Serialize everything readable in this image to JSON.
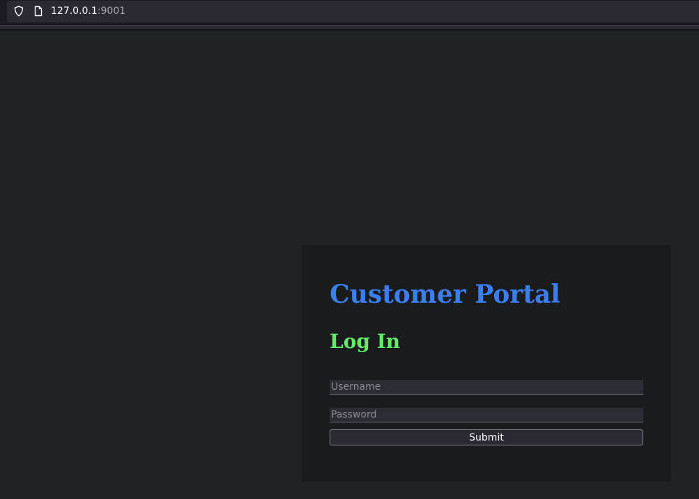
{
  "browser": {
    "url_host": "127.0.0.1",
    "url_port": ":9001",
    "icons": {
      "security": "shield-icon",
      "page": "page-icon"
    }
  },
  "card": {
    "portal_title": "Customer Portal",
    "login_title": "Log In",
    "username_placeholder": "Username",
    "password_placeholder": "Password",
    "submit_label": "Submit"
  },
  "colors": {
    "page_background": "#202324",
    "card_background": "#1a1b1d",
    "portal_title": "#3b7ef0",
    "login_title": "#62ea6b"
  }
}
